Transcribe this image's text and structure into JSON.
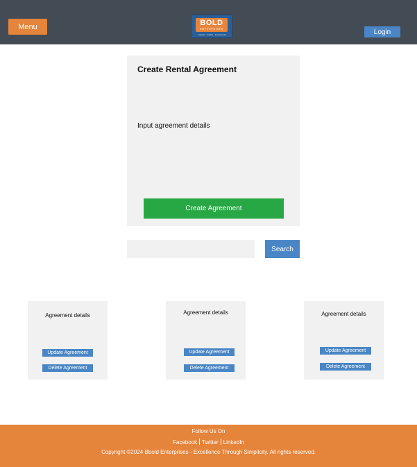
{
  "header": {
    "menu_label": "Menu",
    "login_label": "Login",
    "logo": {
      "word": "BOLD",
      "sub": "ENTERPRISES",
      "tagline": "Assets · Credits · Investments"
    },
    "colors": {
      "bar": "#434c54",
      "accent": "#e5843b",
      "button": "#4a86c5"
    }
  },
  "create_panel": {
    "title": "Create Rental Agreement",
    "description": "Input agreement details",
    "submit_label": "Create Agreement",
    "submit_color": "#28a745"
  },
  "search": {
    "placeholder": "",
    "value": "",
    "button_label": "Search"
  },
  "agreements": [
    {
      "title": "Agreement details",
      "update_label": "Update Agreement",
      "delete_label": "Delete Agreement"
    },
    {
      "title": "Agreement details",
      "update_label": "Update Agreement",
      "delete_label": "Delete Agreement"
    },
    {
      "title": "Agreement details",
      "update_label": "Update Agreement",
      "delete_label": "Delete Agreement"
    }
  ],
  "footer": {
    "follow_label": "Follow Us On",
    "links": [
      "Facebook",
      "Twitter",
      "LinkedIn"
    ],
    "copyright": "Copyright ©2024 Bbold Enterprises - Excellence Through Simplicity. All rights reserved."
  }
}
